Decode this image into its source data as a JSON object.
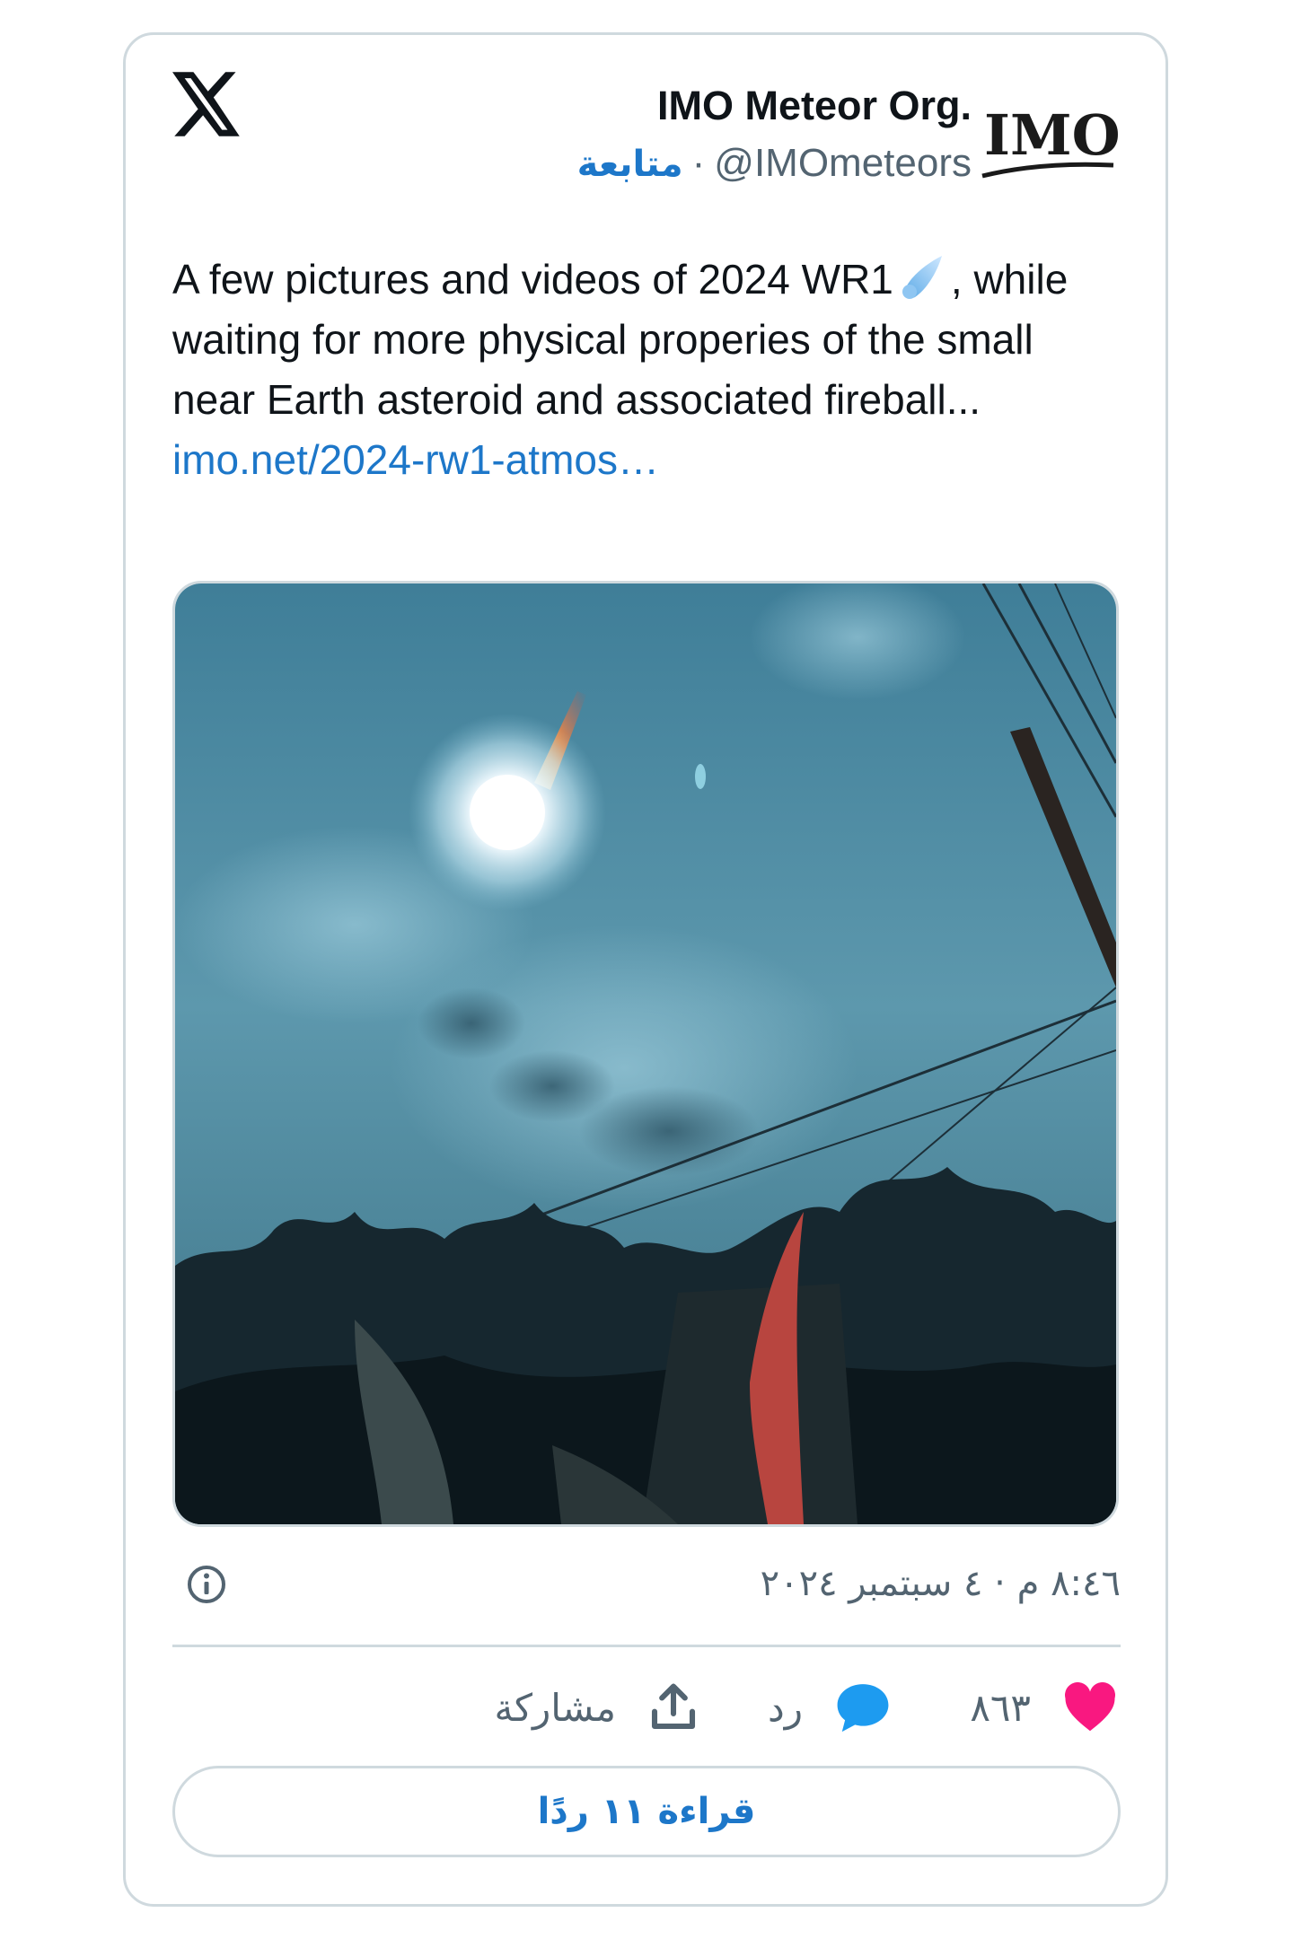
{
  "author": {
    "name": "IMO Meteor Org.",
    "handle": "@IMOmeteors",
    "separator": "·",
    "follow_label": "متابعة",
    "avatar_logo_text": "IMO"
  },
  "tweet": {
    "text_before_emoji": "A few pictures and videos of 2024 WR1",
    "emoji": "comet-emoji",
    "text_after_emoji": ", while waiting for more physical properies of the small near Earth asteroid and associated fireball...",
    "link": "imo.net/2024-rw1-atmos…"
  },
  "media": {
    "description_icon": "photo"
  },
  "meta": {
    "timestamp": "٨:٤٦ م · ٤ سبتمبر ٢٠٢٤",
    "info_icon": "info-icon"
  },
  "actions": {
    "like_count": "٨٦٣",
    "reply_label": "رد",
    "share_label": "مشاركة"
  },
  "read_replies_label": "قراءة ١١ ردًا",
  "colors": {
    "accent": "#1d77c9",
    "like": "#f91880",
    "reply": "#1d9bf0",
    "border": "#cfd9de",
    "muted": "#536471"
  }
}
